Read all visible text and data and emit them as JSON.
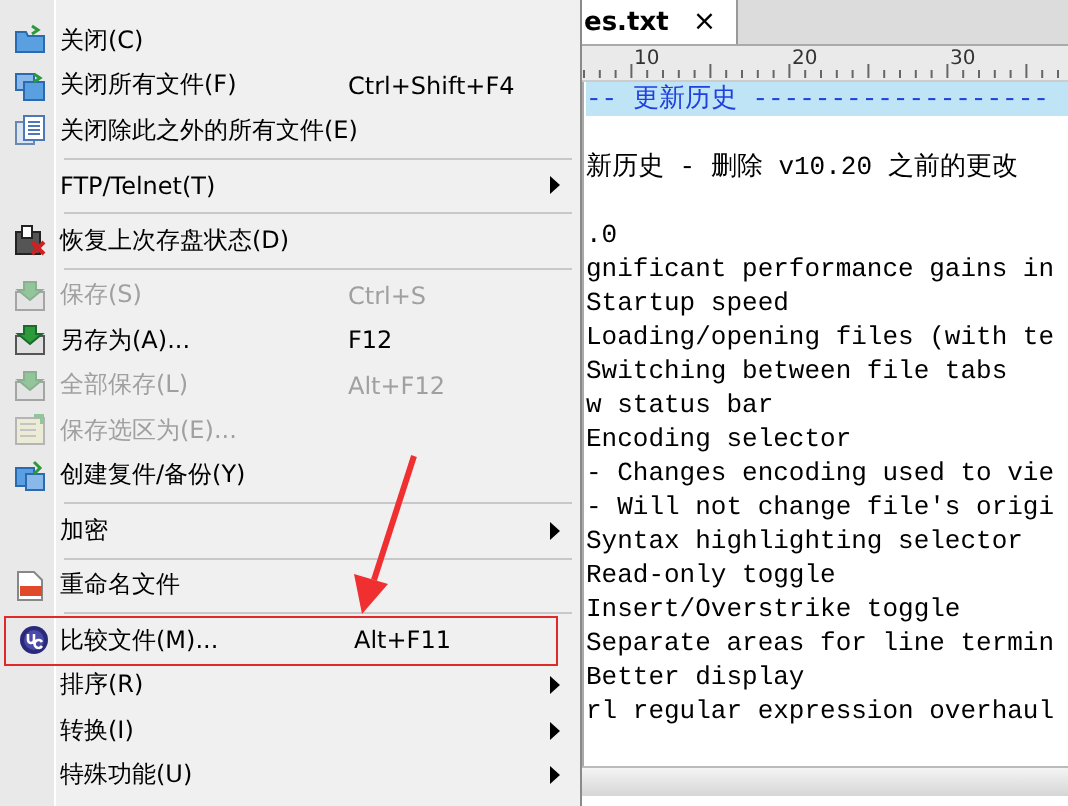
{
  "menu": {
    "items": [
      {
        "kind": "item",
        "label": "关闭(C)",
        "disabled": false,
        "submenu": false,
        "highlighted": false
      },
      {
        "kind": "item",
        "label": "关闭所有文件(F)",
        "shortcut": "Ctrl+Shift+F4",
        "disabled": false,
        "submenu": false,
        "highlighted": false
      },
      {
        "kind": "item",
        "label": "关闭除此之外的所有文件(E)",
        "disabled": false,
        "submenu": false,
        "highlighted": false
      },
      {
        "kind": "separator"
      },
      {
        "kind": "item",
        "label": "FTP/Telnet(T)",
        "disabled": false,
        "submenu": true,
        "highlighted": false
      },
      {
        "kind": "separator"
      },
      {
        "kind": "item",
        "label": "恢复上次存盘状态(D)",
        "disabled": false,
        "submenu": false,
        "highlighted": false
      },
      {
        "kind": "separator"
      },
      {
        "kind": "item",
        "label": "保存(S)",
        "shortcut": "Ctrl+S",
        "disabled": true,
        "submenu": false,
        "highlighted": false
      },
      {
        "kind": "item",
        "label": "另存为(A)...",
        "shortcut": "F12",
        "disabled": false,
        "submenu": false,
        "highlighted": false
      },
      {
        "kind": "item",
        "label": "全部保存(L)",
        "shortcut": "Alt+F12",
        "disabled": true,
        "submenu": false,
        "highlighted": false
      },
      {
        "kind": "item",
        "label": "保存选区为(E)...",
        "disabled": true,
        "submenu": false,
        "highlighted": false
      },
      {
        "kind": "item",
        "label": "创建复件/备份(Y)",
        "disabled": false,
        "submenu": false,
        "highlighted": false
      },
      {
        "kind": "separator"
      },
      {
        "kind": "item",
        "label": "加密",
        "disabled": false,
        "submenu": true,
        "highlighted": false
      },
      {
        "kind": "separator"
      },
      {
        "kind": "item",
        "label": "重命名文件",
        "disabled": false,
        "submenu": false,
        "highlighted": false
      },
      {
        "kind": "separator"
      },
      {
        "kind": "item",
        "label": "比较文件(M)...",
        "shortcut": "Alt+F11",
        "disabled": false,
        "submenu": false,
        "highlighted": true
      },
      {
        "kind": "item",
        "label": "排序(R)",
        "disabled": false,
        "submenu": true,
        "highlighted": false
      },
      {
        "kind": "item",
        "label": "转换(I)",
        "disabled": false,
        "submenu": true,
        "highlighted": false
      },
      {
        "kind": "item",
        "label": "特殊功能(U)",
        "disabled": false,
        "submenu": true,
        "highlighted": false
      }
    ]
  },
  "editor": {
    "tab": {
      "title": "es.txt",
      "close": "×"
    },
    "ruler": [
      "10",
      "20",
      "30"
    ],
    "lines": [
      {
        "kind": "text",
        "text": "-- 更新历史 -------------------",
        "highlighted": true
      },
      {
        "kind": "blank"
      },
      {
        "kind": "text",
        "text": "新历史 - 删除 v10.20 之前的更改",
        "highlighted": false
      },
      {
        "kind": "blank"
      },
      {
        "kind": "text",
        "text": ".0",
        "highlighted": false
      },
      {
        "kind": "text",
        "text": "gnificant performance gains in",
        "highlighted": false
      },
      {
        "kind": "text",
        "text": "Startup speed",
        "highlighted": false
      },
      {
        "kind": "text",
        "text": "Loading/opening files (with te",
        "highlighted": false
      },
      {
        "kind": "text",
        "text": "Switching between file tabs",
        "highlighted": false
      },
      {
        "kind": "text",
        "text": "w status bar",
        "highlighted": false
      },
      {
        "kind": "text",
        "text": "Encoding selector",
        "highlighted": false
      },
      {
        "kind": "text",
        "text": "- Changes encoding used to vie",
        "highlighted": false
      },
      {
        "kind": "text",
        "text": "- Will not change file's origi",
        "highlighted": false
      },
      {
        "kind": "text",
        "text": "Syntax highlighting selector",
        "highlighted": false
      },
      {
        "kind": "text",
        "text": "Read-only toggle",
        "highlighted": false
      },
      {
        "kind": "text",
        "text": "Insert/Overstrike toggle",
        "highlighted": false
      },
      {
        "kind": "text",
        "text": "Separate areas for line termin",
        "highlighted": false
      },
      {
        "kind": "text",
        "text": "Better display",
        "highlighted": false
      },
      {
        "kind": "text",
        "text": "rl regular expression overhaul",
        "highlighted": false
      }
    ]
  }
}
